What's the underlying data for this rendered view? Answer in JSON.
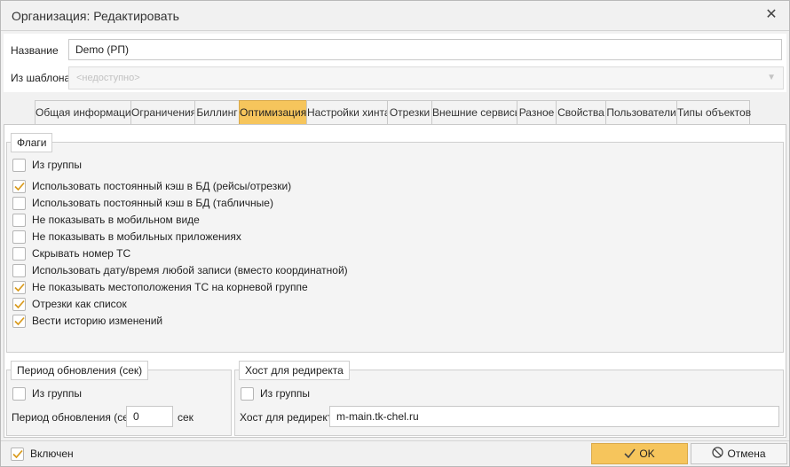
{
  "window": {
    "title": "Организация: Редактировать"
  },
  "form": {
    "name_label": "Название",
    "name_value": "Demo (РП)",
    "template_label": "Из шаблона",
    "template_value": "<недоступно>"
  },
  "tabs": [
    {
      "label": "Общая информация",
      "active": false
    },
    {
      "label": "Ограничения",
      "active": false
    },
    {
      "label": "Биллинг",
      "active": false
    },
    {
      "label": "Оптимизация",
      "active": true
    },
    {
      "label": "Настройки хинта",
      "active": false
    },
    {
      "label": "Отрезки",
      "active": false
    },
    {
      "label": "Внешние сервисы",
      "active": false
    },
    {
      "label": "Разное",
      "active": false
    },
    {
      "label": "Свойства",
      "active": false
    },
    {
      "label": "Пользователи",
      "active": false
    },
    {
      "label": "Типы объектов",
      "active": false
    }
  ],
  "flags": {
    "title": "Флаги",
    "from_group": {
      "label": "Из группы",
      "checked": false
    },
    "items": [
      {
        "label": "Использовать постоянный кэш в БД (рейсы/отрезки)",
        "checked": true
      },
      {
        "label": "Использовать постоянный кэш в БД (табличные)",
        "checked": false
      },
      {
        "label": "Не показывать в мобильном виде",
        "checked": false
      },
      {
        "label": "Не показывать в мобильных приложениях",
        "checked": false
      },
      {
        "label": "Скрывать номер ТС",
        "checked": false
      },
      {
        "label": "Использовать дату/время любой записи (вместо координатной)",
        "checked": false
      },
      {
        "label": "Не показывать местоположения ТС на корневой группе",
        "checked": true
      },
      {
        "label": "Отрезки как список",
        "checked": true
      },
      {
        "label": "Вести историю изменений",
        "checked": true
      }
    ]
  },
  "refresh": {
    "title": "Период обновления (сек)",
    "from_group": {
      "label": "Из группы",
      "checked": false
    },
    "period_label": "Период обновления (сек)",
    "period_value": "0",
    "unit": "сек"
  },
  "redirect": {
    "title": "Хост для редиректа",
    "from_group": {
      "label": "Из группы",
      "checked": false
    },
    "host_label": "Хост для редиректа",
    "host_value": "m-main.tk-chel.ru"
  },
  "footer": {
    "enabled": {
      "label": "Включен",
      "checked": true
    },
    "ok_label": "OK",
    "cancel_label": "Отмена"
  },
  "colors": {
    "accent": "#f6c55c",
    "check": "#d99a1c"
  }
}
